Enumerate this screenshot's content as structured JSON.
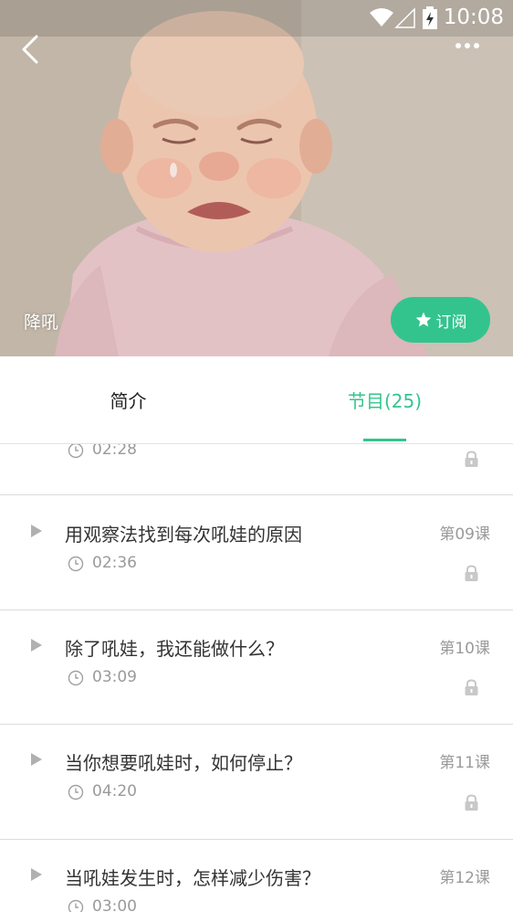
{
  "status_bar": {
    "time": "10:08"
  },
  "header": {
    "title": "降吼",
    "subscribe_label": "订阅",
    "colors": {
      "accent": "#33c48e"
    }
  },
  "tabs": [
    {
      "label": "简介",
      "active": false
    },
    {
      "label": "节目(25)",
      "active": true
    }
  ],
  "lessons": [
    {
      "title": "",
      "duration": "02:28",
      "number": "",
      "locked": true
    },
    {
      "title": "用观察法找到每次吼娃的原因",
      "duration": "02:36",
      "number": "第09课",
      "locked": true
    },
    {
      "title": "除了吼娃，我还能做什么？",
      "duration": "03:09",
      "number": "第10课",
      "locked": true
    },
    {
      "title": "当你想要吼娃时，如何停止？",
      "duration": "04:20",
      "number": "第11课",
      "locked": true
    },
    {
      "title": "当吼娃发生时，怎样减少伤害？",
      "duration": "03:00",
      "number": "第12课",
      "locked": true
    }
  ]
}
